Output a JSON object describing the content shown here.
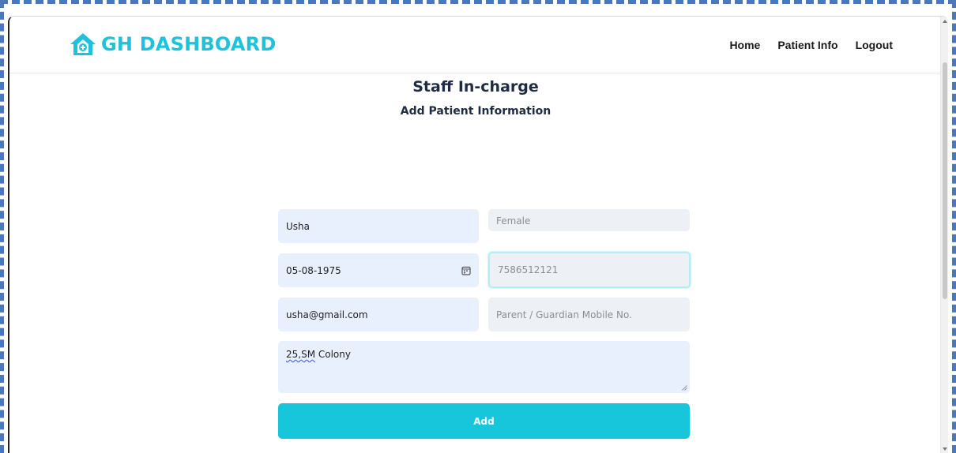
{
  "brand": {
    "name": "GH DASHBOARD",
    "icon": "home-plus-icon",
    "color": "#1ec3da"
  },
  "nav": {
    "links": [
      "Home",
      "Patient Info",
      "Logout"
    ]
  },
  "page": {
    "title": "Staff In-charge",
    "subtitle": "Add Patient Information"
  },
  "form": {
    "name": {
      "value": "Usha"
    },
    "gender": {
      "placeholder": "Female"
    },
    "dob": {
      "value": "05-08-1975",
      "icon": "calendar-icon"
    },
    "mobile": {
      "placeholder": "7586512121"
    },
    "email": {
      "value": "usha@gmail.com"
    },
    "guardian_mobile": {
      "placeholder": "Parent / Guardian Mobile No."
    },
    "address": {
      "value_part1": "25,SM",
      "value_part2": " Colony"
    },
    "submit_label": "Add",
    "accent": "#18c6dc"
  }
}
